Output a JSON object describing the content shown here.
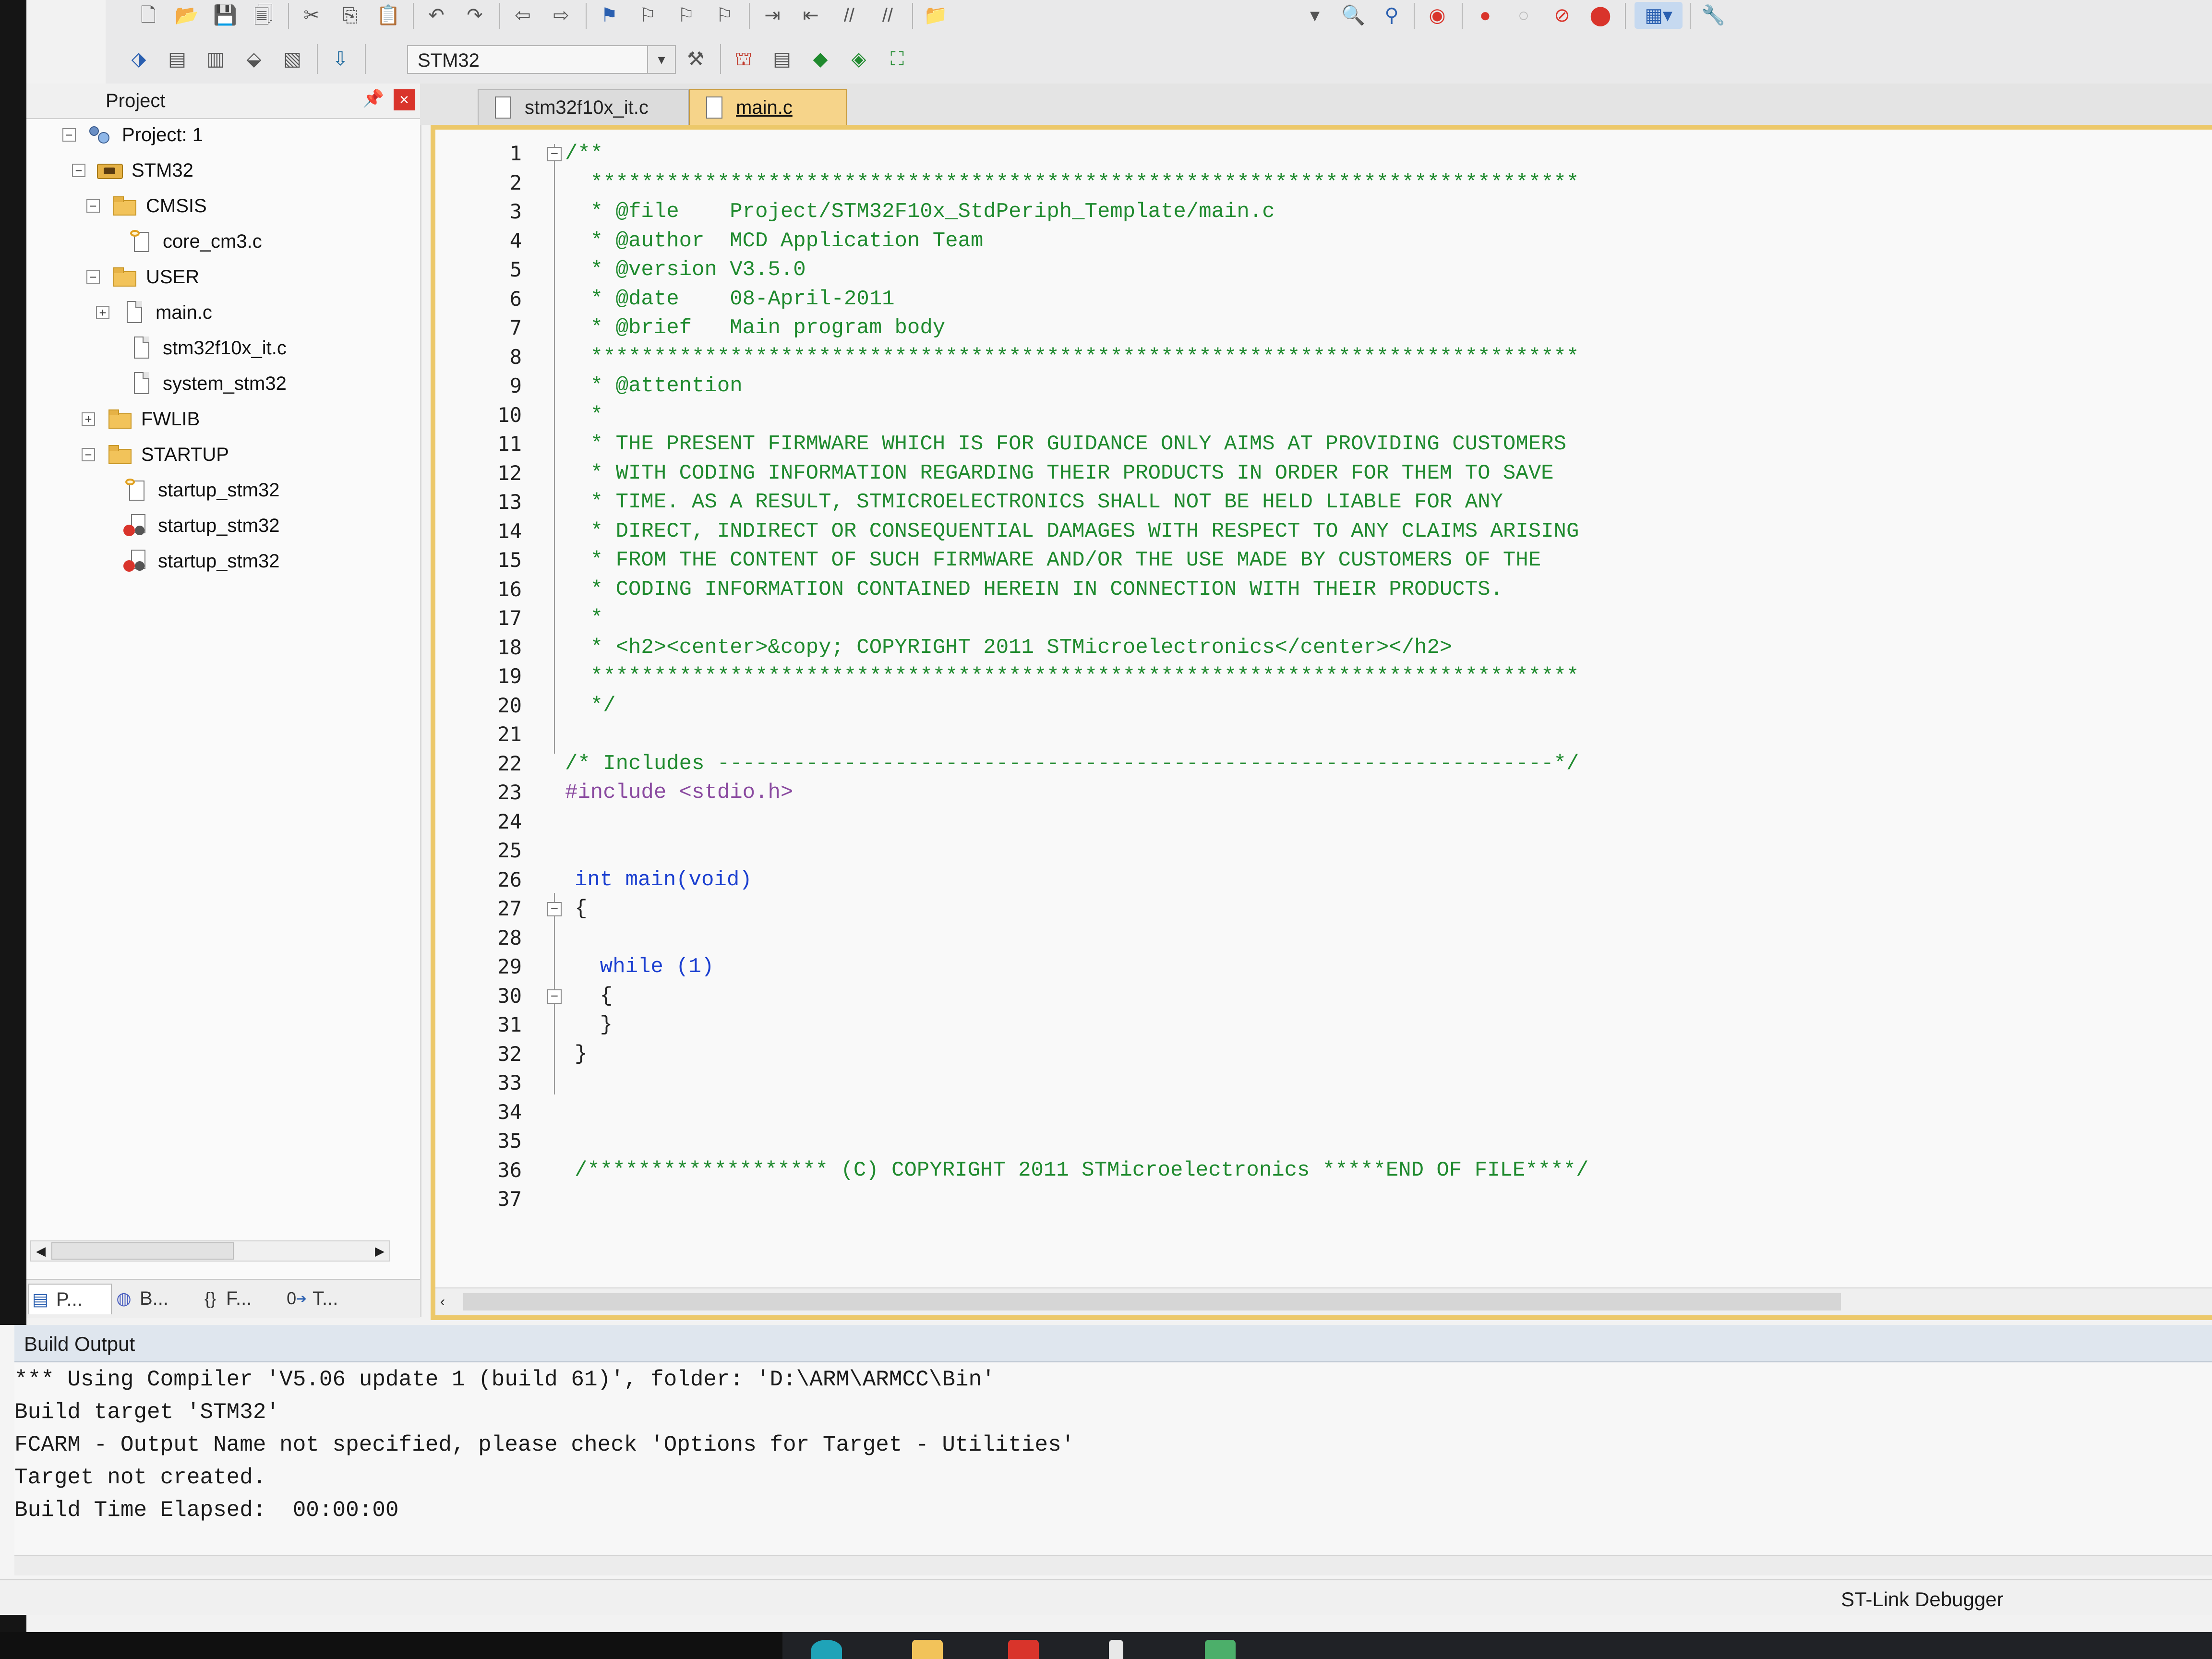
{
  "toolbar": {
    "target_name": "STM32"
  },
  "project_panel": {
    "title": "Project",
    "tree": [
      {
        "label": "Project: 1",
        "toggle": "−",
        "icon": "project-icon"
      },
      {
        "label": "STM32",
        "toggle": "−",
        "icon": "target-icon"
      },
      {
        "label": "CMSIS",
        "toggle": "−",
        "icon": "folder-icon"
      },
      {
        "label": "core_cm3.c",
        "toggle": "",
        "icon": "keyfile-icon"
      },
      {
        "label": "USER",
        "toggle": "−",
        "icon": "folder-icon"
      },
      {
        "label": "main.c",
        "toggle": "+",
        "icon": "file-icon"
      },
      {
        "label": "stm32f10x_it.c",
        "toggle": "",
        "icon": "file-icon"
      },
      {
        "label": "system_stm32",
        "toggle": "",
        "icon": "file-icon"
      },
      {
        "label": "FWLIB",
        "toggle": "+",
        "icon": "folder-icon"
      },
      {
        "label": "STARTUP",
        "toggle": "−",
        "icon": "folder-icon"
      },
      {
        "label": "startup_stm32",
        "toggle": "",
        "icon": "keyfile-icon"
      },
      {
        "label": "startup_stm32",
        "toggle": "",
        "icon": "asmfile-icon"
      },
      {
        "label": "startup_stm32",
        "toggle": "",
        "icon": "asmfile-icon"
      }
    ],
    "tabs": [
      {
        "label": "P...",
        "icon": "project-tab-icon"
      },
      {
        "label": "B...",
        "icon": "books-tab-icon"
      },
      {
        "label": "F...",
        "icon": "functions-tab-icon"
      },
      {
        "label": "T...",
        "icon": "templates-tab-icon"
      }
    ]
  },
  "editor": {
    "tabs": [
      {
        "label": "stm32f10x_it.c",
        "active": false
      },
      {
        "label": "main.c",
        "active": true
      }
    ],
    "lines": [
      {
        "n": "1",
        "text": "/**",
        "cls": "c-cmt",
        "fold": "−"
      },
      {
        "n": "2",
        "text": "  ******************************************************************************",
        "cls": "c-cmt"
      },
      {
        "n": "3",
        "text": "  * @file    Project/STM32F10x_StdPeriph_Template/main.c",
        "cls": "c-cmt"
      },
      {
        "n": "4",
        "text": "  * @author  MCD Application Team",
        "cls": "c-cmt"
      },
      {
        "n": "5",
        "text": "  * @version V3.5.0",
        "cls": "c-cmt"
      },
      {
        "n": "6",
        "text": "  * @date    08-April-2011",
        "cls": "c-cmt"
      },
      {
        "n": "7",
        "text": "  * @brief   Main program body",
        "cls": "c-cmt"
      },
      {
        "n": "8",
        "text": "  ******************************************************************************",
        "cls": "c-cmt"
      },
      {
        "n": "9",
        "text": "  * @attention",
        "cls": "c-cmt"
      },
      {
        "n": "10",
        "text": "  *",
        "cls": "c-cmt"
      },
      {
        "n": "11",
        "text": "  * THE PRESENT FIRMWARE WHICH IS FOR GUIDANCE ONLY AIMS AT PROVIDING CUSTOMERS",
        "cls": "c-cmt"
      },
      {
        "n": "12",
        "text": "  * WITH CODING INFORMATION REGARDING THEIR PRODUCTS IN ORDER FOR THEM TO SAVE",
        "cls": "c-cmt"
      },
      {
        "n": "13",
        "text": "  * TIME. AS A RESULT, STMICROELECTRONICS SHALL NOT BE HELD LIABLE FOR ANY",
        "cls": "c-cmt"
      },
      {
        "n": "14",
        "text": "  * DIRECT, INDIRECT OR CONSEQUENTIAL DAMAGES WITH RESPECT TO ANY CLAIMS ARISING",
        "cls": "c-cmt"
      },
      {
        "n": "15",
        "text": "  * FROM THE CONTENT OF SUCH FIRMWARE AND/OR THE USE MADE BY CUSTOMERS OF THE",
        "cls": "c-cmt"
      },
      {
        "n": "16",
        "text": "  * CODING INFORMATION CONTAINED HEREIN IN CONNECTION WITH THEIR PRODUCTS.",
        "cls": "c-cmt"
      },
      {
        "n": "17",
        "text": "  *",
        "cls": "c-cmt"
      },
      {
        "n": "18",
        "text": "  * <h2><center>&copy; COPYRIGHT 2011 STMicroelectronics</center></h2>",
        "cls": "c-cmt"
      },
      {
        "n": "19",
        "text": "  ******************************************************************************",
        "cls": "c-cmt"
      },
      {
        "n": "20",
        "text": "  */",
        "cls": "c-cmt"
      },
      {
        "n": "21",
        "text": "",
        "cls": ""
      },
      {
        "n": "22",
        "text": "/* Includes ------------------------------------------------------------------*/",
        "cls": "c-cmt"
      },
      {
        "n": "23",
        "text": "#include <stdio.h>",
        "cls": "c-pp"
      },
      {
        "n": "24",
        "text": "",
        "cls": ""
      },
      {
        "n": "25",
        "text": "",
        "cls": ""
      },
      {
        "n": "26",
        "text": "int main(void)",
        "cls": "c-kw"
      },
      {
        "n": "27",
        "text": "{",
        "cls": "",
        "fold": "−"
      },
      {
        "n": "28",
        "text": "",
        "cls": ""
      },
      {
        "n": "29",
        "text": "  while (1)",
        "cls": "c-kw"
      },
      {
        "n": "30",
        "text": "  {",
        "cls": "",
        "fold": "−"
      },
      {
        "n": "31",
        "text": "  }",
        "cls": ""
      },
      {
        "n": "32",
        "text": "}",
        "cls": ""
      },
      {
        "n": "33",
        "text": "",
        "cls": ""
      },
      {
        "n": "34",
        "text": "",
        "cls": ""
      },
      {
        "n": "35",
        "text": "",
        "cls": ""
      },
      {
        "n": "36",
        "text": "/******************* (C) COPYRIGHT 2011 STMicroelectronics *****END OF FILE****/",
        "cls": "c-cmt"
      },
      {
        "n": "37",
        "text": "",
        "cls": ""
      }
    ]
  },
  "build_output": {
    "title": "Build Output",
    "lines": [
      "*** Using Compiler 'V5.06 update 1 (build 61)', folder: 'D:\\ARM\\ARMCC\\Bin'",
      "Build target 'STM32'",
      "FCARM - Output Name not specified, please check 'Options for Target - Utilities'",
      "Target not created.",
      "Build Time Elapsed:  00:00:00"
    ]
  },
  "status_bar": {
    "debugger": "ST-Link Debugger"
  },
  "colors": {
    "comment": "#1f8a2e",
    "keyword": "#1b3fd0",
    "preprocessor": "#8a4aa0",
    "active_tab": "#f6d48a",
    "editor_border": "#ecc86a",
    "build_header": "#dfe6ee"
  }
}
